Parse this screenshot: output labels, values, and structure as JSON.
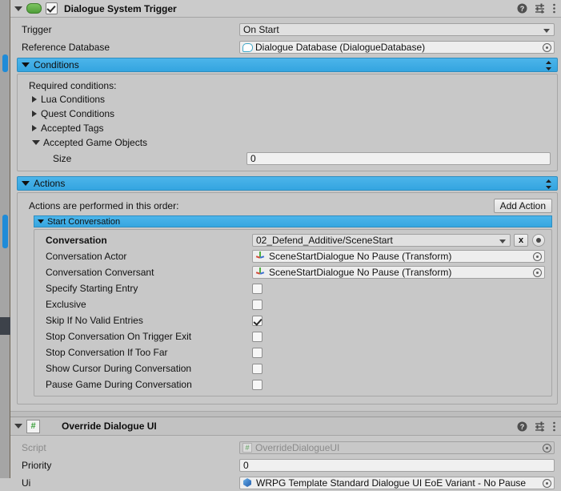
{
  "components": [
    {
      "title": "Dialogue System Trigger",
      "icon": "dialogue-system-icon",
      "enabled": true,
      "header_icons": [
        "help-icon",
        "preset-icon",
        "kebab-menu-icon"
      ]
    },
    {
      "title": "Override Dialogue UI",
      "icon": "cs-script-icon",
      "header_icons": [
        "help-icon",
        "preset-icon",
        "kebab-menu-icon"
      ]
    }
  ],
  "trigger": {
    "label": "Trigger",
    "value": "On Start"
  },
  "reference_database": {
    "label": "Reference Database",
    "value": "Dialogue Database (DialogueDatabase)",
    "icon": "dialogue-database-icon"
  },
  "conditions": {
    "bar_label": "Conditions",
    "hint": "Required conditions:",
    "foldouts": [
      {
        "label": "Lua Conditions",
        "open": false
      },
      {
        "label": "Quest Conditions",
        "open": false
      },
      {
        "label": "Accepted Tags",
        "open": false
      },
      {
        "label": "Accepted Game Objects",
        "open": true
      }
    ],
    "size": {
      "label": "Size",
      "value": "0"
    }
  },
  "actions": {
    "bar_label": "Actions",
    "hint": "Actions are performed in this order:",
    "add_action_label": "Add Action",
    "sub_label": "Start Conversation",
    "conversation": {
      "label": "Conversation",
      "value": "02_Defend_Additive/SceneStart",
      "clear_label": "x"
    },
    "conversation_actor": {
      "label": "Conversation Actor",
      "value": "SceneStartDialogue No Pause (Transform)",
      "icon": "transform-icon"
    },
    "conversation_conversant": {
      "label": "Conversation Conversant",
      "value": "SceneStartDialogue No Pause (Transform)",
      "icon": "transform-icon"
    },
    "toggles": [
      {
        "label": "Specify Starting Entry",
        "checked": false
      },
      {
        "label": "Exclusive",
        "checked": false
      },
      {
        "label": "Skip If No Valid Entries",
        "checked": true
      },
      {
        "label": "Stop Conversation On Trigger Exit",
        "checked": false
      },
      {
        "label": "Stop Conversation If Too Far",
        "checked": false
      },
      {
        "label": "Show Cursor During Conversation",
        "checked": false
      },
      {
        "label": "Pause Game During Conversation",
        "checked": false
      }
    ]
  },
  "override_dialogue_ui": {
    "script": {
      "label": "Script",
      "value": "OverrideDialogueUI",
      "icon": "cs-script-icon"
    },
    "priority": {
      "label": "Priority",
      "value": "0"
    },
    "ui": {
      "label": "Ui",
      "value": "WRPG Template Standard Dialogue UI EoE Variant - No Pause",
      "icon": "prefab-icon"
    }
  },
  "colors": {
    "accent_blue": "#34a5e0",
    "panel_bg": "#c8c8c8",
    "field_bg": "#eeeeee",
    "scrollbar_thumb": "#1f8bd8"
  }
}
